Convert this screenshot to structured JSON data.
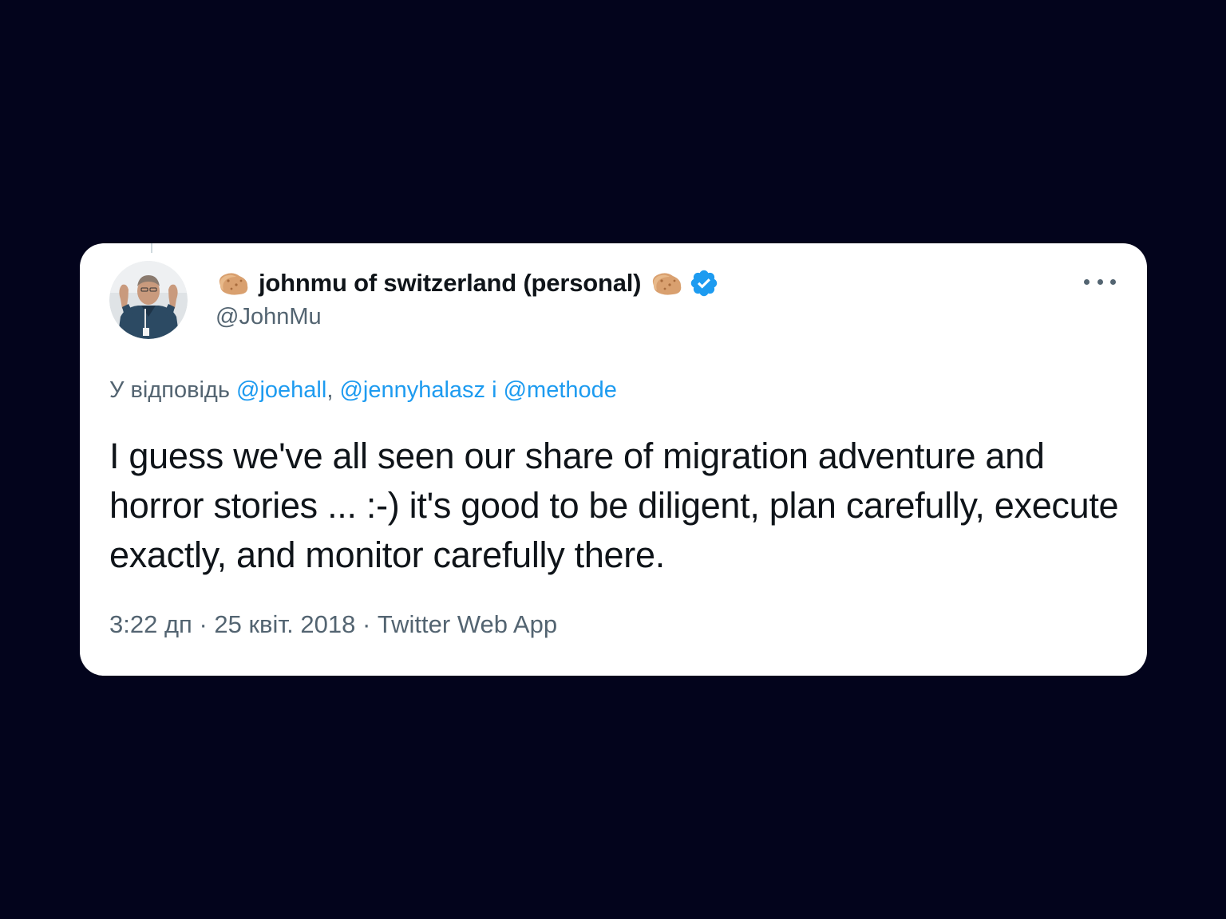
{
  "tweet": {
    "display_name": "johnmu of switzerland (personal)",
    "handle": "@JohnMu",
    "reply": {
      "prefix": "У відповідь",
      "mention_1": "@joehall",
      "separator_1": ", ",
      "mention_2": "@jennyhalasz",
      "separator_2": " і ",
      "mention_3": "@methode"
    },
    "text": "I guess we've all seen our share of migration adventure and horror stories ... :-) it's good to be diligent, plan carefully, execute exactly, and monitor carefully there.",
    "time": "3:22 дп",
    "dot_1": " · ",
    "date": "25 квіт. 2018",
    "dot_2": " · ",
    "source": "Twitter Web App"
  },
  "icons": {
    "name_emoji": "potato-icon",
    "verified": "verified-badge-icon",
    "more": "more-icon"
  },
  "colors": {
    "background": "#03041c",
    "card": "#ffffff",
    "link": "#1d9bf0",
    "secondary_text": "#536471",
    "primary_text": "#0f1419"
  }
}
